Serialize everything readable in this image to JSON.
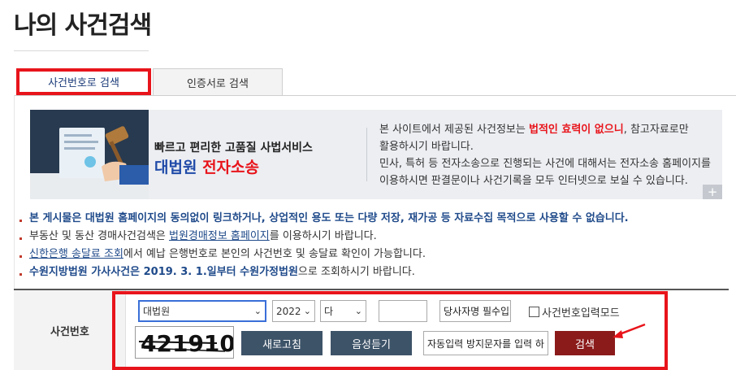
{
  "page": {
    "title": "나의 사건검색"
  },
  "tabs": [
    {
      "label": "사건번호로 검색",
      "active": true
    },
    {
      "label": "인증서로 검색",
      "active": false
    }
  ],
  "banner": {
    "slogan": "빠르고 편리한 고품질 사법서비스",
    "brand_main": "대법원",
    "brand_sub": "전자소송",
    "desc1_pre": "본 사이트에서 제공된 사건정보는 ",
    "desc1_strong": "법적인 효력이 없으니",
    "desc1_post": ", 참고자료로만",
    "desc2": "활용하시기 바랍니다.",
    "desc3": "민사, 특허 등 전자소송으로 진행되는 사건에 대해서는 전자소송 홈페이지를",
    "desc4": "이용하시면 판결문이나 사건기록을 모두 인터넷으로 보실 수 있습니다.",
    "plus": "+"
  },
  "notices": {
    "n1": "본 게시물은 대법원 홈페이지의 동의없이 링크하거나, 상업적인 용도 또는 다량 저장, 재가공 등 자료수집 목적으로 사용할 수 없습니다.",
    "n2_pre": "부동산 및 동산 경매사건검색은 ",
    "n2_link": "법원경매정보 홈페이지",
    "n2_post": "를 이용하시기 바랍니다.",
    "n3_link": "신한은행 송달료 조회",
    "n3_post": "에서 예납 은행번호로 본인의 사건번호 및 송달료 확인이 가능합니다.",
    "n4_strong": "수원지방법원 가사사건은 2019. 3. 1.일부터 수원가정법원",
    "n4_post": "으로 조회하시기 바랍니다."
  },
  "form": {
    "label": "사건번호",
    "court_value": "대법원",
    "year_value": "2022",
    "case_type_value": "다",
    "case_number_value": "",
    "party_name_placeholder": "당사자명 필수입",
    "checkbox_label": "사건번호입력모드",
    "captcha_text": "421910",
    "refresh_label": "새로고침",
    "audio_label": "음성듣기",
    "captcha_input_placeholder": "자동입력 방지문자를 입력 하",
    "search_label": "검색"
  },
  "colors": {
    "highlight": "#e8141b",
    "navy_button": "#3d5368",
    "search_button": "#8b1a1a",
    "link_blue": "#1f4a8a"
  }
}
